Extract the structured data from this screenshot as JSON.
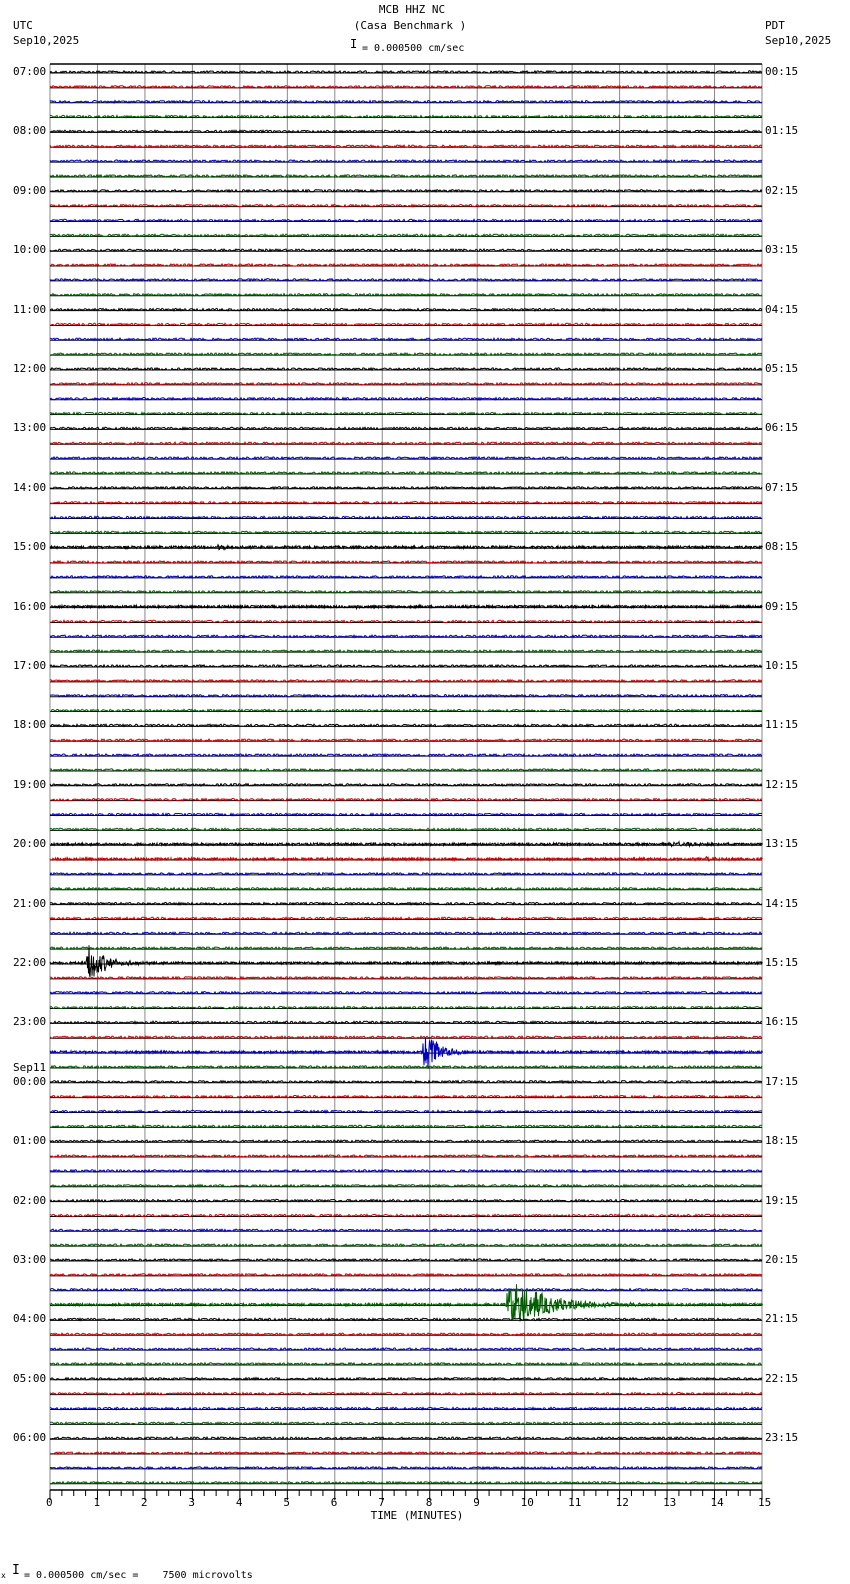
{
  "header": {
    "title": "MCB HHZ NC",
    "subtitle": "(Casa Benchmark )",
    "left_tz": "UTC",
    "left_date": "Sep10,2025",
    "right_tz": "PDT",
    "right_date": "Sep10,2025",
    "scale": "= 0.000500 cm/sec"
  },
  "footer": {
    "scale": "= 0.000500 cm/sec =    7500 microvolts",
    "marker": "x"
  },
  "chart_data": {
    "type": "line",
    "title": "MCB HHZ NC (Casa Benchmark )",
    "xlabel": "TIME (MINUTES)",
    "xlim": [
      0,
      15
    ],
    "x_ticks": [
      "0",
      "1",
      "2",
      "3",
      "4",
      "5",
      "6",
      "7",
      "8",
      "9",
      "10",
      "11",
      "12",
      "13",
      "14",
      "15"
    ],
    "rows_per_hour": 4,
    "trace_colors": [
      "#000000",
      "#d00000",
      "#0000c0",
      "#006000"
    ],
    "date_change": {
      "label": "Sep11",
      "before_left_label_index": 17
    },
    "left_labels": [
      "07:00",
      "08:00",
      "09:00",
      "10:00",
      "11:00",
      "12:00",
      "13:00",
      "14:00",
      "15:00",
      "16:00",
      "17:00",
      "18:00",
      "19:00",
      "20:00",
      "21:00",
      "22:00",
      "23:00",
      "00:00",
      "01:00",
      "02:00",
      "03:00",
      "04:00",
      "05:00",
      "06:00"
    ],
    "right_labels": [
      "00:15",
      "01:15",
      "02:15",
      "03:15",
      "04:15",
      "05:15",
      "06:15",
      "07:15",
      "08:15",
      "09:15",
      "10:15",
      "11:15",
      "12:15",
      "13:15",
      "14:15",
      "15:15",
      "16:15",
      "17:15",
      "18:15",
      "19:15",
      "20:15",
      "21:15",
      "22:15",
      "23:15"
    ],
    "events": [
      {
        "row": 32,
        "start_min": 3.5,
        "duration_min": 0.5,
        "amplitude": 3
      },
      {
        "row": 36,
        "start_min": 6.4,
        "duration_min": 0.2,
        "amplitude": 2
      },
      {
        "row": 52,
        "start_min": 13.0,
        "duration_min": 1.2,
        "amplitude": 2.5
      },
      {
        "row": 53,
        "start_min": 13.8,
        "duration_min": 0.4,
        "amplitude": 2.5
      },
      {
        "row": 60,
        "start_min": 0.75,
        "duration_min": 0.8,
        "amplitude": 22
      },
      {
        "row": 66,
        "start_min": 7.85,
        "duration_min": 0.6,
        "amplitude": 28
      },
      {
        "row": 83,
        "start_min": 9.6,
        "duration_min": 1.8,
        "amplitude": 26
      }
    ]
  }
}
